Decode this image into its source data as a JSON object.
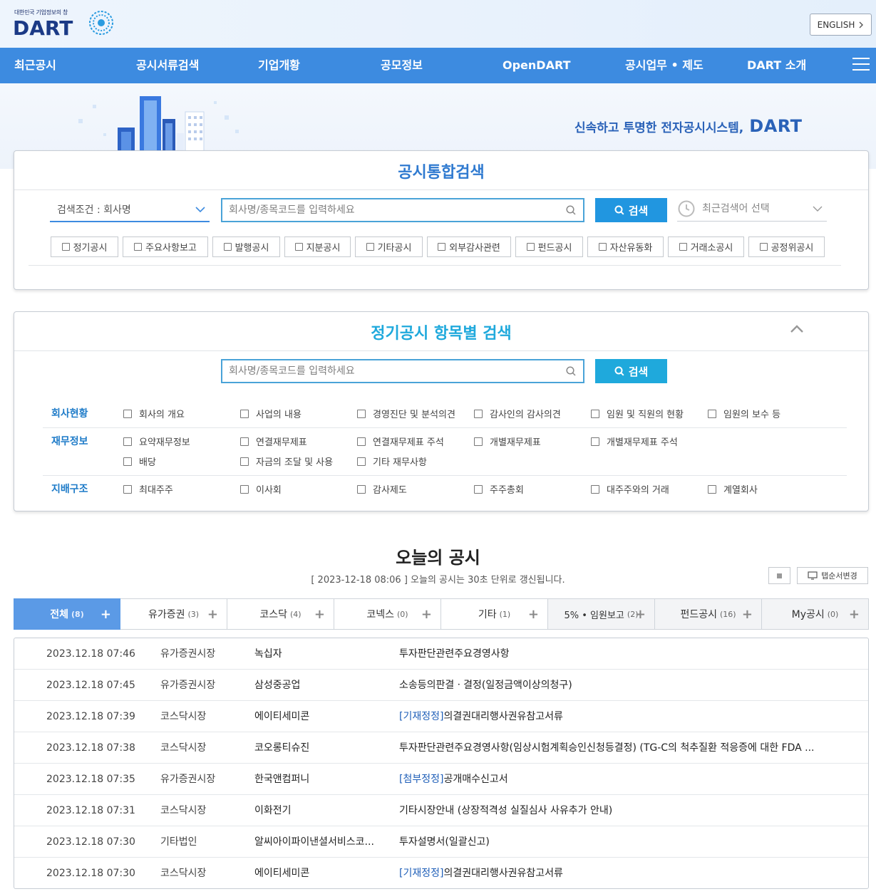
{
  "header": {
    "logo_subtitle": "대한민국 기업정보의 창",
    "logo_text": "DART",
    "lang_button": "ENGLISH"
  },
  "nav": {
    "items": [
      "최근공시",
      "공시서류검색",
      "기업개황",
      "공모정보",
      "OpenDART",
      "공시업무 • 제도",
      "DART 소개"
    ]
  },
  "banner": {
    "slogan": "신속하고 투명한 전자공시시스템,",
    "brand": "DART"
  },
  "integrated_search": {
    "title": "공시통합검색",
    "condition": "검색조건 : 회사명",
    "placeholder": "회사명/종목코드를 입력하세요",
    "search_button": "검색",
    "recent_label": "최근검색어 선택",
    "filters": [
      "정기공시",
      "주요사항보고",
      "발행공시",
      "지분공시",
      "기타공시",
      "외부감사관련",
      "펀드공시",
      "자산유동화",
      "거래소공시",
      "공정위공시"
    ]
  },
  "periodic_search": {
    "title": "정기공시 항목별 검색",
    "placeholder": "회사명/종목코드를 입력하세요",
    "search_button": "검색",
    "categories": [
      {
        "label": "회사현황",
        "options": [
          "회사의 개요",
          "사업의 내용",
          "경영진단 및 분석의견",
          "감사인의 감사의견",
          "임원 및 직원의 현황",
          "임원의 보수 등"
        ]
      },
      {
        "label": "재무정보",
        "options": [
          "요약재무정보",
          "연결재무제표",
          "연결재무제표 주석",
          "개별재무제표",
          "개별재무제표 주석",
          "배당",
          "자금의 조달 및 사용",
          "기타 재무사항"
        ]
      },
      {
        "label": "지배구조",
        "options": [
          "최대주주",
          "이사회",
          "감사제도",
          "주주총회",
          "대주주와의 거래",
          "계열회사"
        ]
      }
    ]
  },
  "today": {
    "title": "오늘의 공시",
    "updated": "2023-12-18 08:06",
    "notice": "오늘의 공시는 30초 단위로 갱신됩니다.",
    "tab_order_button": "탭순서변경",
    "tabs": [
      {
        "label": "전체",
        "count": "(8)"
      },
      {
        "label": "유가증권",
        "count": "(3)"
      },
      {
        "label": "코스닥",
        "count": "(4)"
      },
      {
        "label": "코넥스",
        "count": "(0)"
      },
      {
        "label": "기타",
        "count": "(1)"
      },
      {
        "label": "5% • 임원보고",
        "count": "(2)"
      },
      {
        "label": "펀드공시",
        "count": "(16)"
      },
      {
        "label": "My공시",
        "count": "(0)"
      }
    ],
    "rows": [
      {
        "time": "2023.12.18 07:46",
        "market": "유가증권시장",
        "company": "녹십자",
        "tag": "",
        "report": "투자판단관련주요경영사항"
      },
      {
        "time": "2023.12.18 07:45",
        "market": "유가증권시장",
        "company": "삼성중공업",
        "tag": "",
        "report": "소송등의판결ㆍ결정(일정금액이상의청구)"
      },
      {
        "time": "2023.12.18 07:39",
        "market": "코스닥시장",
        "company": "에이티세미콘",
        "tag": "[기재정정]",
        "report": "의결권대리행사권유참고서류"
      },
      {
        "time": "2023.12.18 07:38",
        "market": "코스닥시장",
        "company": "코오롱티슈진",
        "tag": "",
        "report": "투자판단관련주요경영사항(임상시험계획승인신청등결정) (TG-C의 척추질환 적응증에 대한 FDA ..."
      },
      {
        "time": "2023.12.18 07:35",
        "market": "유가증권시장",
        "company": "한국앤컴퍼니",
        "tag": "[첨부정정]",
        "report": "공개매수신고서"
      },
      {
        "time": "2023.12.18 07:31",
        "market": "코스닥시장",
        "company": "이화전기",
        "tag": "",
        "report": "기타시장안내 (상장적격성 실질심사 사유추가 안내)"
      },
      {
        "time": "2023.12.18 07:30",
        "market": "기타법인",
        "company": "알씨아이파이낸셜서비스코...",
        "tag": "",
        "report": "투자설명서(일괄신고)"
      },
      {
        "time": "2023.12.18 07:30",
        "market": "코스닥시장",
        "company": "에이티세미콘",
        "tag": "[기재정정]",
        "report": "의결권대리행사권유참고서류"
      }
    ]
  },
  "colors": {
    "nav_bg": "#3d8be0",
    "brand": "#1b3a86",
    "accent": "#2a62b8",
    "search_btn": "#2196e0",
    "periodic_title": "#1fa9dc"
  }
}
